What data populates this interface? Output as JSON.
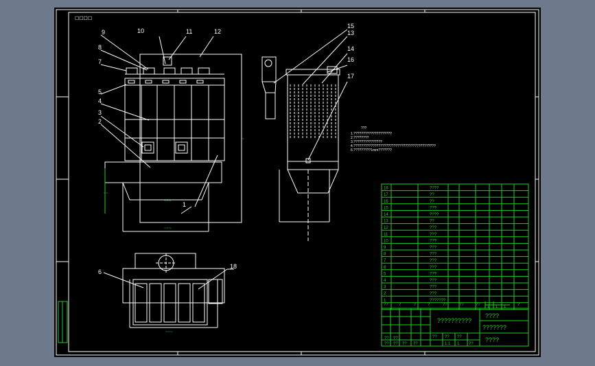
{
  "colors": {
    "background": "#6e7a8c",
    "sheet": "#000000",
    "lines": "#ffffff",
    "table": "#1fd01f"
  },
  "corner_tag": "☐☐☐☐",
  "callouts": [
    "1",
    "2",
    "3",
    "4",
    "5",
    "6",
    "7",
    "8",
    "9",
    "10",
    "11",
    "12",
    "13",
    "14",
    "15",
    "16",
    "17",
    "18"
  ],
  "notes": {
    "title": "???",
    "lines": [
      "1.????????????????????",
      "2.????????",
      "3.???????????????",
      "4.???????????????????????????????????????????",
      "5.?????????1mm???????"
    ]
  },
  "parts_table": {
    "rows": [
      {
        "no": "18",
        "name": "????"
      },
      {
        "no": "17",
        "name": "??"
      },
      {
        "no": "16",
        "name": "??"
      },
      {
        "no": "15",
        "name": "???"
      },
      {
        "no": "14",
        "name": "????"
      },
      {
        "no": "13",
        "name": "??"
      },
      {
        "no": "12",
        "name": "???"
      },
      {
        "no": "11",
        "name": "???"
      },
      {
        "no": "10",
        "name": "???"
      },
      {
        "no": "9",
        "name": "???"
      },
      {
        "no": "8",
        "name": "???"
      },
      {
        "no": "7",
        "name": "???"
      },
      {
        "no": "6",
        "name": "???"
      },
      {
        "no": "5",
        "name": "???"
      },
      {
        "no": "4",
        "name": "???"
      },
      {
        "no": "3",
        "name": "???"
      },
      {
        "no": "2",
        "name": "???"
      },
      {
        "no": "1",
        "name": "???????"
      }
    ],
    "header": [
      "??",
      "?",
      "?",
      "?",
      "??",
      "??",
      "??",
      "?"
    ]
  },
  "title_block": {
    "drawing_name": "??????????",
    "company_top": "????",
    "company_mid": "???????",
    "company_bot": "????",
    "small_cells": [
      "??",
      "??",
      "??",
      "??",
      "??",
      "??",
      "??",
      "??",
      "??",
      "1:1",
      "1",
      "??"
    ],
    "scale_cells": [
      "1",
      "1",
      "1"
    ]
  }
}
